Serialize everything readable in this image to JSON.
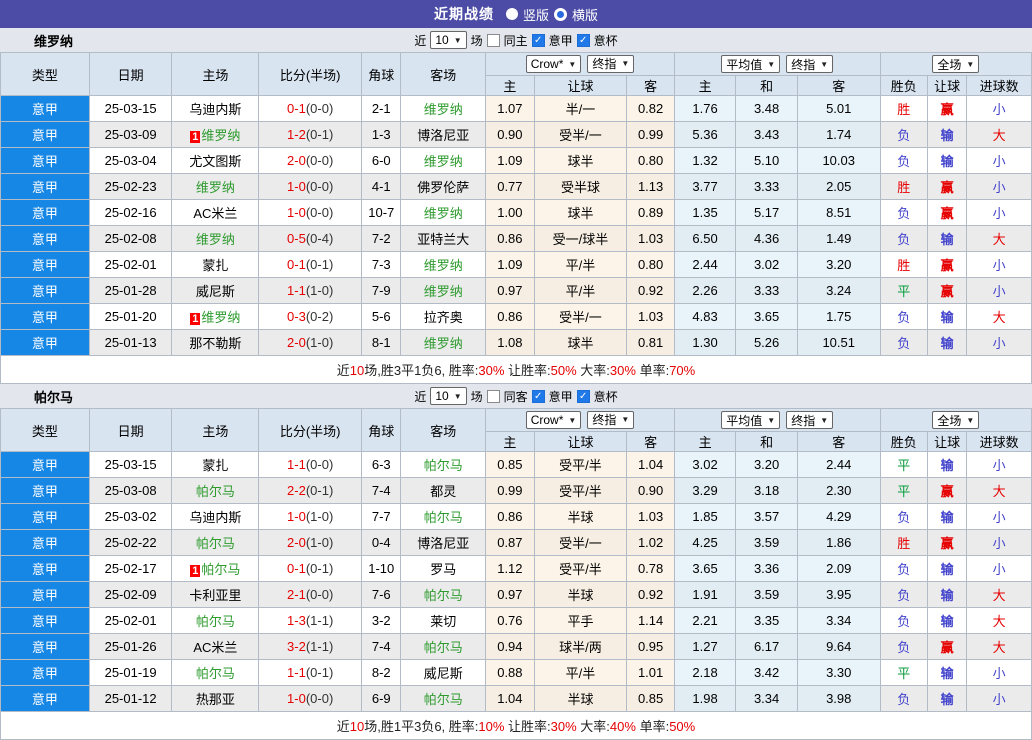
{
  "title_bar": {
    "title": "近期战绩",
    "vertical": "竖版",
    "horizontal": "横版"
  },
  "filters": {
    "near": "近",
    "count": "10",
    "matches": "场",
    "league": "意甲",
    "cup": "意杯"
  },
  "selects": {
    "odds_source": "Crow*",
    "final_odds": "终指",
    "average": "平均值",
    "final_odds2": "终指",
    "full_match": "全场"
  },
  "columns": {
    "type": "类型",
    "date": "日期",
    "home": "主场",
    "score": "比分(半场)",
    "corner": "角球",
    "away": "客场",
    "odds_home": "主",
    "odds_handicap": "让球",
    "odds_away": "客",
    "avg_home": "主",
    "avg_draw": "和",
    "avg_away": "客",
    "result_wl": "胜负",
    "result_handicap": "让球",
    "result_goals": "进球数"
  },
  "sections": [
    {
      "team": "维罗纳",
      "same": "同主",
      "rows": [
        {
          "league": "意甲",
          "date": "25-03-15",
          "home": "乌迪内斯",
          "home_hl": false,
          "home_badge": false,
          "score": "0-1",
          "half": "(0-0)",
          "corner": "2-1",
          "away": "维罗纳",
          "away_hl": true,
          "odds": [
            "1.07",
            "半/一",
            "0.82"
          ],
          "avg": [
            "1.76",
            "3.48",
            "5.01"
          ],
          "res": [
            "胜",
            "赢",
            "小"
          ]
        },
        {
          "league": "意甲",
          "date": "25-03-09",
          "home": "维罗纳",
          "home_hl": true,
          "home_badge": true,
          "score": "1-2",
          "half": "(0-1)",
          "corner": "1-3",
          "away": "博洛尼亚",
          "away_hl": false,
          "odds": [
            "0.90",
            "受半/一",
            "0.99"
          ],
          "avg": [
            "5.36",
            "3.43",
            "1.74"
          ],
          "res": [
            "负",
            "输",
            "大"
          ]
        },
        {
          "league": "意甲",
          "date": "25-03-04",
          "home": "尤文图斯",
          "home_hl": false,
          "home_badge": false,
          "score": "2-0",
          "half": "(0-0)",
          "corner": "6-0",
          "away": "维罗纳",
          "away_hl": true,
          "odds": [
            "1.09",
            "球半",
            "0.80"
          ],
          "avg": [
            "1.32",
            "5.10",
            "10.03"
          ],
          "res": [
            "负",
            "输",
            "小"
          ]
        },
        {
          "league": "意甲",
          "date": "25-02-23",
          "home": "维罗纳",
          "home_hl": true,
          "home_badge": false,
          "score": "1-0",
          "half": "(0-0)",
          "corner": "4-1",
          "away": "佛罗伦萨",
          "away_hl": false,
          "odds": [
            "0.77",
            "受半球",
            "1.13"
          ],
          "avg": [
            "3.77",
            "3.33",
            "2.05"
          ],
          "res": [
            "胜",
            "赢",
            "小"
          ]
        },
        {
          "league": "意甲",
          "date": "25-02-16",
          "home": "AC米兰",
          "home_hl": false,
          "home_badge": false,
          "score": "1-0",
          "half": "(0-0)",
          "corner": "10-7",
          "away": "维罗纳",
          "away_hl": true,
          "odds": [
            "1.00",
            "球半",
            "0.89"
          ],
          "avg": [
            "1.35",
            "5.17",
            "8.51"
          ],
          "res": [
            "负",
            "赢",
            "小"
          ]
        },
        {
          "league": "意甲",
          "date": "25-02-08",
          "home": "维罗纳",
          "home_hl": true,
          "home_badge": false,
          "score": "0-5",
          "half": "(0-4)",
          "corner": "7-2",
          "away": "亚特兰大",
          "away_hl": false,
          "odds": [
            "0.86",
            "受一/球半",
            "1.03"
          ],
          "avg": [
            "6.50",
            "4.36",
            "1.49"
          ],
          "res": [
            "负",
            "输",
            "大"
          ]
        },
        {
          "league": "意甲",
          "date": "25-02-01",
          "home": "蒙扎",
          "home_hl": false,
          "home_badge": false,
          "score": "0-1",
          "half": "(0-1)",
          "corner": "7-3",
          "away": "维罗纳",
          "away_hl": true,
          "odds": [
            "1.09",
            "平/半",
            "0.80"
          ],
          "avg": [
            "2.44",
            "3.02",
            "3.20"
          ],
          "res": [
            "胜",
            "赢",
            "小"
          ]
        },
        {
          "league": "意甲",
          "date": "25-01-28",
          "home": "威尼斯",
          "home_hl": false,
          "home_badge": false,
          "score": "1-1",
          "half": "(1-0)",
          "corner": "7-9",
          "away": "维罗纳",
          "away_hl": true,
          "odds": [
            "0.97",
            "平/半",
            "0.92"
          ],
          "avg": [
            "2.26",
            "3.33",
            "3.24"
          ],
          "res": [
            "平",
            "赢",
            "小"
          ]
        },
        {
          "league": "意甲",
          "date": "25-01-20",
          "home": "维罗纳",
          "home_hl": true,
          "home_badge": true,
          "score": "0-3",
          "half": "(0-2)",
          "corner": "5-6",
          "away": "拉齐奥",
          "away_hl": false,
          "odds": [
            "0.86",
            "受半/一",
            "1.03"
          ],
          "avg": [
            "4.83",
            "3.65",
            "1.75"
          ],
          "res": [
            "负",
            "输",
            "大"
          ]
        },
        {
          "league": "意甲",
          "date": "25-01-13",
          "home": "那不勒斯",
          "home_hl": false,
          "home_badge": false,
          "score": "2-0",
          "half": "(1-0)",
          "corner": "8-1",
          "away": "维罗纳",
          "away_hl": true,
          "odds": [
            "1.08",
            "球半",
            "0.81"
          ],
          "avg": [
            "1.30",
            "5.26",
            "10.51"
          ],
          "res": [
            "负",
            "输",
            "小"
          ]
        }
      ],
      "summary": [
        [
          "近",
          "d"
        ],
        [
          "10",
          "r"
        ],
        [
          "场,胜3平1负6, 胜率:",
          "d"
        ],
        [
          "30%",
          "r"
        ],
        [
          " 让胜率:",
          "d"
        ],
        [
          "50%",
          "r"
        ],
        [
          " 大率:",
          "d"
        ],
        [
          "30%",
          "r"
        ],
        [
          " 单率:",
          "d"
        ],
        [
          "70%",
          "r"
        ]
      ]
    },
    {
      "team": "帕尔马",
      "same": "同客",
      "rows": [
        {
          "league": "意甲",
          "date": "25-03-15",
          "home": "蒙扎",
          "home_hl": false,
          "home_badge": false,
          "score": "1-1",
          "half": "(0-0)",
          "corner": "6-3",
          "away": "帕尔马",
          "away_hl": true,
          "odds": [
            "0.85",
            "受平/半",
            "1.04"
          ],
          "avg": [
            "3.02",
            "3.20",
            "2.44"
          ],
          "res": [
            "平",
            "输",
            "小"
          ]
        },
        {
          "league": "意甲",
          "date": "25-03-08",
          "home": "帕尔马",
          "home_hl": true,
          "home_badge": false,
          "score": "2-2",
          "half": "(0-1)",
          "corner": "7-4",
          "away": "都灵",
          "away_hl": false,
          "odds": [
            "0.99",
            "受平/半",
            "0.90"
          ],
          "avg": [
            "3.29",
            "3.18",
            "2.30"
          ],
          "res": [
            "平",
            "赢",
            "大"
          ]
        },
        {
          "league": "意甲",
          "date": "25-03-02",
          "home": "乌迪内斯",
          "home_hl": false,
          "home_badge": false,
          "score": "1-0",
          "half": "(1-0)",
          "corner": "7-7",
          "away": "帕尔马",
          "away_hl": true,
          "odds": [
            "0.86",
            "半球",
            "1.03"
          ],
          "avg": [
            "1.85",
            "3.57",
            "4.29"
          ],
          "res": [
            "负",
            "输",
            "小"
          ]
        },
        {
          "league": "意甲",
          "date": "25-02-22",
          "home": "帕尔马",
          "home_hl": true,
          "home_badge": false,
          "score": "2-0",
          "half": "(1-0)",
          "corner": "0-4",
          "away": "博洛尼亚",
          "away_hl": false,
          "odds": [
            "0.87",
            "受半/一",
            "1.02"
          ],
          "avg": [
            "4.25",
            "3.59",
            "1.86"
          ],
          "res": [
            "胜",
            "赢",
            "小"
          ]
        },
        {
          "league": "意甲",
          "date": "25-02-17",
          "home": "帕尔马",
          "home_hl": true,
          "home_badge": true,
          "score": "0-1",
          "half": "(0-1)",
          "corner": "1-10",
          "away": "罗马",
          "away_hl": false,
          "odds": [
            "1.12",
            "受平/半",
            "0.78"
          ],
          "avg": [
            "3.65",
            "3.36",
            "2.09"
          ],
          "res": [
            "负",
            "输",
            "小"
          ]
        },
        {
          "league": "意甲",
          "date": "25-02-09",
          "home": "卡利亚里",
          "home_hl": false,
          "home_badge": false,
          "score": "2-1",
          "half": "(0-0)",
          "corner": "7-6",
          "away": "帕尔马",
          "away_hl": true,
          "odds": [
            "0.97",
            "半球",
            "0.92"
          ],
          "avg": [
            "1.91",
            "3.59",
            "3.95"
          ],
          "res": [
            "负",
            "输",
            "大"
          ]
        },
        {
          "league": "意甲",
          "date": "25-02-01",
          "home": "帕尔马",
          "home_hl": true,
          "home_badge": false,
          "score": "1-3",
          "half": "(1-1)",
          "corner": "3-2",
          "away": "莱切",
          "away_hl": false,
          "odds": [
            "0.76",
            "平手",
            "1.14"
          ],
          "avg": [
            "2.21",
            "3.35",
            "3.34"
          ],
          "res": [
            "负",
            "输",
            "大"
          ]
        },
        {
          "league": "意甲",
          "date": "25-01-26",
          "home": "AC米兰",
          "home_hl": false,
          "home_badge": false,
          "score": "3-2",
          "half": "(1-1)",
          "corner": "7-4",
          "away": "帕尔马",
          "away_hl": true,
          "odds": [
            "0.94",
            "球半/两",
            "0.95"
          ],
          "avg": [
            "1.27",
            "6.17",
            "9.64"
          ],
          "res": [
            "负",
            "赢",
            "大"
          ]
        },
        {
          "league": "意甲",
          "date": "25-01-19",
          "home": "帕尔马",
          "home_hl": true,
          "home_badge": false,
          "score": "1-1",
          "half": "(0-1)",
          "corner": "8-2",
          "away": "威尼斯",
          "away_hl": false,
          "odds": [
            "0.88",
            "平/半",
            "1.01"
          ],
          "avg": [
            "2.18",
            "3.42",
            "3.30"
          ],
          "res": [
            "平",
            "输",
            "小"
          ]
        },
        {
          "league": "意甲",
          "date": "25-01-12",
          "home": "热那亚",
          "home_hl": false,
          "home_badge": false,
          "score": "1-0",
          "half": "(0-0)",
          "corner": "6-9",
          "away": "帕尔马",
          "away_hl": true,
          "odds": [
            "1.04",
            "半球",
            "0.85"
          ],
          "avg": [
            "1.98",
            "3.34",
            "3.98"
          ],
          "res": [
            "负",
            "输",
            "小"
          ]
        }
      ],
      "summary": [
        [
          "近",
          "d"
        ],
        [
          "10",
          "r"
        ],
        [
          "场,胜1平3负6, 胜率:",
          "d"
        ],
        [
          "10%",
          "r"
        ],
        [
          " 让胜率:",
          "d"
        ],
        [
          "30%",
          "r"
        ],
        [
          " 大率:",
          "d"
        ],
        [
          "40%",
          "r"
        ],
        [
          " 单率:",
          "d"
        ],
        [
          "50%",
          "r"
        ]
      ]
    }
  ]
}
